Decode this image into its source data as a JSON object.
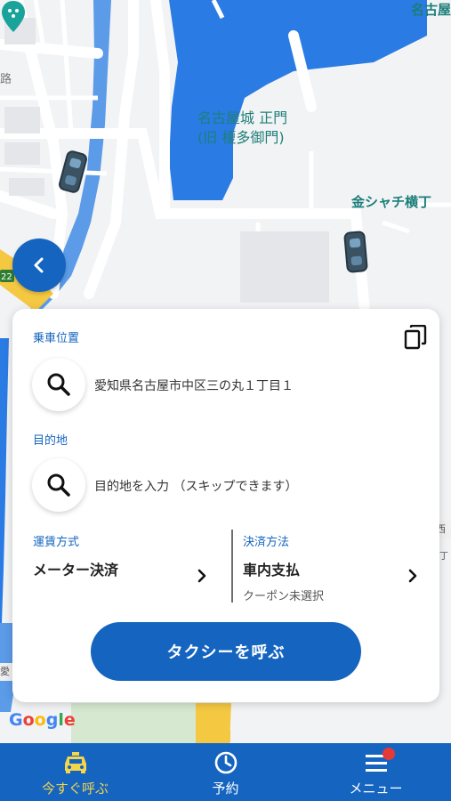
{
  "map": {
    "labels": {
      "castle_line1": "名古屋城 正門",
      "castle_line2": "(旧 榎多御門)",
      "shachi": "金シャチ横丁",
      "nagoya": "名古屋",
      "road": "路"
    },
    "google": "Google",
    "colors": {
      "water": "#2a7be4",
      "road": "#ffffff",
      "land": "#f2f3f5",
      "accent": "#1565c0"
    }
  },
  "back_button": {
    "icon": "chevron-left-icon"
  },
  "card": {
    "pickup": {
      "label": "乗車位置",
      "value": "愛知県名古屋市中区三の丸１丁目１"
    },
    "destination": {
      "label": "目的地",
      "placeholder": "目的地を入力 （スキップできます）"
    },
    "fare": {
      "label": "運賃方式",
      "value": "メーター決済"
    },
    "payment": {
      "label": "決済方法",
      "value": "車内支払",
      "coupon": "クーポン未選択"
    },
    "call_button": "タクシーを呼ぶ"
  },
  "bottom_nav": {
    "items": [
      {
        "label": "今すぐ呼ぶ",
        "icon": "taxi-icon",
        "active": true
      },
      {
        "label": "予約",
        "icon": "clock-icon",
        "active": false
      },
      {
        "label": "メニュー",
        "icon": "menu-icon",
        "active": false
      }
    ],
    "active_color": "#f5d54a"
  }
}
